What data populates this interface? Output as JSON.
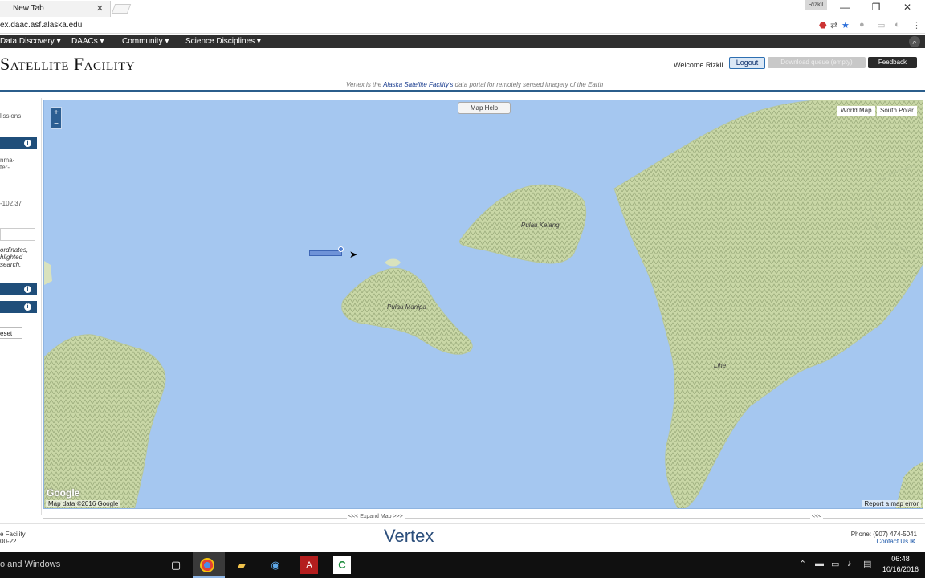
{
  "browser": {
    "tab_title": "New Tab",
    "tab_close": "✕",
    "user_chip": "Rizkil",
    "url": "ex.daac.asf.alaska.edu",
    "window_controls": {
      "minimize": "—",
      "restore": "❐",
      "close": "✕"
    }
  },
  "nav": {
    "items": [
      "Data Discovery ▾",
      "DAACs ▾",
      "Community ▾",
      "Science Disciplines ▾"
    ],
    "search_icon": "search-icon"
  },
  "header": {
    "title": "Satellite Facility",
    "welcome": "Welcome Rizkil",
    "logout": "Logout",
    "queue": "Download queue (empty)",
    "feedback": "Feedback",
    "tagline_pre": "Vertex is the ",
    "tagline_link": "Alaska Satellite Facility's",
    "tagline_post": " data portal for remotely sensed imagery of the Earth"
  },
  "left_panel": {
    "missions": "lissions",
    "desc_line1": "nma-",
    "desc_line2": "ter-",
    "coords": "-102,37",
    "hint_line1": "ordinates,",
    "hint_line2": "hlighted",
    "hint_line3": "search.",
    "reset": "eset"
  },
  "map": {
    "zoom_in": "+",
    "zoom_out": "−",
    "help": "Map Help",
    "world_map": "World Map",
    "south_polar": "South Polar",
    "label_kelang": "Pulau Kelang",
    "label_manipa": "Pulau Manipa",
    "label_town": "Lihe",
    "data_credit": "Map data ©2016 Google",
    "report_error": "Report a map error",
    "google_logo": "Google"
  },
  "expand": {
    "label": "<<< Expand Map >>>",
    "right": "<<<"
  },
  "footer": {
    "left_line1": "e Facility",
    "left_line2": "00-22",
    "brand": "Vertex",
    "phone": "Phone: (907) 474-5041",
    "contact": "Contact Us ✉"
  },
  "taskbar": {
    "search_text": "o and Windows",
    "time": "06:48",
    "date": "10/16/2016"
  }
}
